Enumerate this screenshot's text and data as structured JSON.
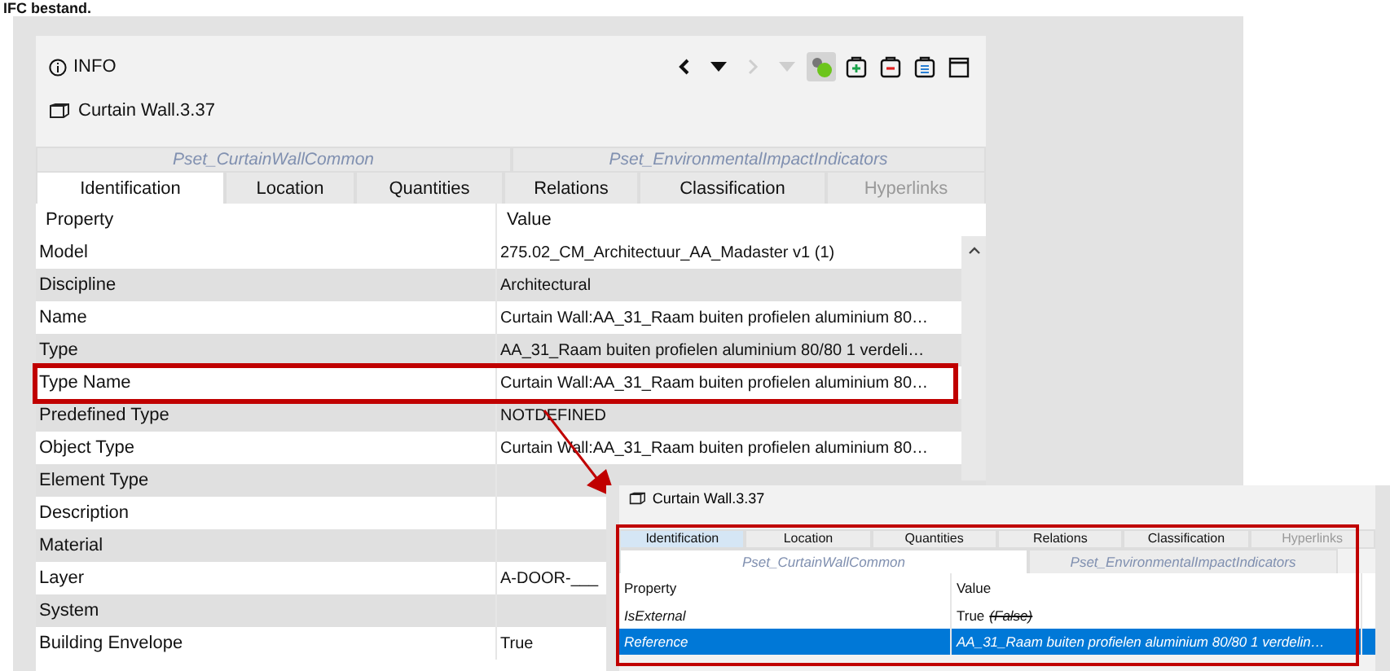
{
  "heading": "IFC bestand.",
  "panel": {
    "title": "INFO",
    "object": "Curtain Wall.3.37",
    "toolbar": [
      {
        "kind": "back",
        "disabled": false,
        "selected": false
      },
      {
        "kind": "dropdown",
        "disabled": false,
        "selected": false
      },
      {
        "kind": "forward",
        "disabled": true,
        "selected": false
      },
      {
        "kind": "dropdown",
        "disabled": true,
        "selected": false
      },
      {
        "kind": "objects",
        "disabled": false,
        "selected": true
      },
      {
        "kind": "add",
        "disabled": false,
        "selected": false
      },
      {
        "kind": "remove",
        "disabled": false,
        "selected": false
      },
      {
        "kind": "list",
        "disabled": false,
        "selected": false
      },
      {
        "kind": "window",
        "disabled": false,
        "selected": false
      }
    ],
    "pset_tabs": [
      {
        "label": "Pset_CurtainWallCommon",
        "selected": false
      },
      {
        "label": "Pset_EnvironmentalImpactIndicators",
        "selected": false
      }
    ],
    "tabs": [
      {
        "label": "Identification",
        "selected": true,
        "disabled": false
      },
      {
        "label": "Location",
        "selected": false,
        "disabled": false
      },
      {
        "label": "Quantities",
        "selected": false,
        "disabled": false
      },
      {
        "label": "Relations",
        "selected": false,
        "disabled": false
      },
      {
        "label": "Classification",
        "selected": false,
        "disabled": false
      },
      {
        "label": "Hyperlinks",
        "selected": false,
        "disabled": true
      }
    ],
    "columns": [
      "Property",
      "Value"
    ],
    "rows": [
      {
        "property": "Model",
        "value": "275.02_CM_Architectuur_AA_Madaster v1 (1)",
        "highlighted": false
      },
      {
        "property": "Discipline",
        "value": "Architectural",
        "highlighted": false
      },
      {
        "property": "Name",
        "value": "Curtain Wall:AA_31_Raam buiten profielen aluminium 80…",
        "highlighted": false
      },
      {
        "property": "Type",
        "value": "AA_31_Raam buiten profielen aluminium 80/80 1 verdeli…",
        "highlighted": false
      },
      {
        "property": "Type Name",
        "value": "Curtain Wall:AA_31_Raam buiten profielen aluminium 80…",
        "highlighted": true
      },
      {
        "property": "Predefined Type",
        "value": "NOTDEFINED",
        "highlighted": false
      },
      {
        "property": "Object Type",
        "value": "Curtain Wall:AA_31_Raam buiten profielen aluminium 80…",
        "highlighted": false
      },
      {
        "property": "Element Type",
        "value": "",
        "highlighted": false
      },
      {
        "property": "Description",
        "value": "",
        "highlighted": false
      },
      {
        "property": "Material",
        "value": "",
        "highlighted": false
      },
      {
        "property": "Layer",
        "value": "A-DOOR-___",
        "highlighted": false
      },
      {
        "property": "System",
        "value": "",
        "highlighted": false
      },
      {
        "property": "Building Envelope",
        "value": "True",
        "highlighted": false
      }
    ]
  },
  "inset": {
    "object": "Curtain Wall.3.37",
    "tabs": [
      {
        "label": "Identification",
        "selected": true,
        "disabled": false
      },
      {
        "label": "Location",
        "selected": false,
        "disabled": false
      },
      {
        "label": "Quantities",
        "selected": false,
        "disabled": false
      },
      {
        "label": "Relations",
        "selected": false,
        "disabled": false
      },
      {
        "label": "Classification",
        "selected": false,
        "disabled": false
      },
      {
        "label": "Hyperlinks",
        "selected": false,
        "disabled": true
      }
    ],
    "pset_tabs": [
      {
        "label": "Pset_CurtainWallCommon",
        "selected": true
      },
      {
        "label": "Pset_EnvironmentalImpactIndicators",
        "selected": false
      }
    ],
    "columns": [
      "Property",
      "Value"
    ],
    "rows": [
      {
        "property": "IsExternal",
        "value": "True",
        "previous": "(False)",
        "selected": false
      },
      {
        "property": "Reference",
        "value": "AA_31_Raam buiten profielen aluminium 80/80 1 verdelin…",
        "previous": "",
        "selected": true
      }
    ]
  }
}
